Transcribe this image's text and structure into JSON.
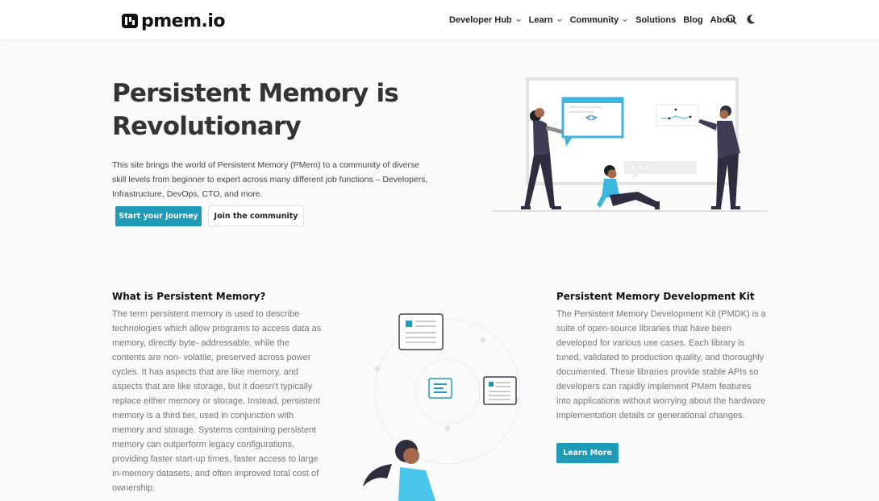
{
  "brand": {
    "name": "pmem.io",
    "accent": "#1f9bb8"
  },
  "nav": {
    "items": [
      {
        "label": "Developer Hub",
        "dropdown": true
      },
      {
        "label": "Learn",
        "dropdown": true
      },
      {
        "label": "Community",
        "dropdown": true
      },
      {
        "label": "Solutions",
        "dropdown": false
      },
      {
        "label": "Blog",
        "dropdown": false
      },
      {
        "label": "About",
        "dropdown": false
      }
    ],
    "icons": [
      "search-icon",
      "moon-icon"
    ]
  },
  "hero": {
    "title_line1": "Persistent Memory is",
    "title_line2": "Revolutionary",
    "text": "This site brings the world of Persistent Memory (PMem) to a community of diverse skill levels from beginner to expert across many different job functions – Developers, Infrastructure, DevOps, CTO, and more.",
    "primary_button": "Start your journey",
    "secondary_button": "Join the community"
  },
  "what_is": {
    "title": "What is Persistent Memory?",
    "text": "The term persistent memory is used to describe technologies which allow programs to access data as memory, directly byte- addressable, while the contents are non- volatile, preserved across power cycles. It has aspects that are like memory, and aspects that are like storage, but it doesn’t typically replace either memory or storage. Instead, persistent memory is a third tier, used in conjunction with memory and storage. Systems containing persistent memory can outperform legacy configurations, providing faster start-up times, faster access to large in-memory datasets, and often improved total cost of ownership."
  },
  "pmdk": {
    "title": "Persistent Memory Development Kit",
    "text": "The Persistent Memory Development Kit (PMDK) is a suite of open-source libraries that have been developed for various use cases. Each library is tuned, validated to production quality, and thoroughly documented. These libraries provide stable APIs so developers can rapidly implement PMem features into applications without worrying about the hardware implementation details or generational changes.",
    "button": "Learn More"
  }
}
